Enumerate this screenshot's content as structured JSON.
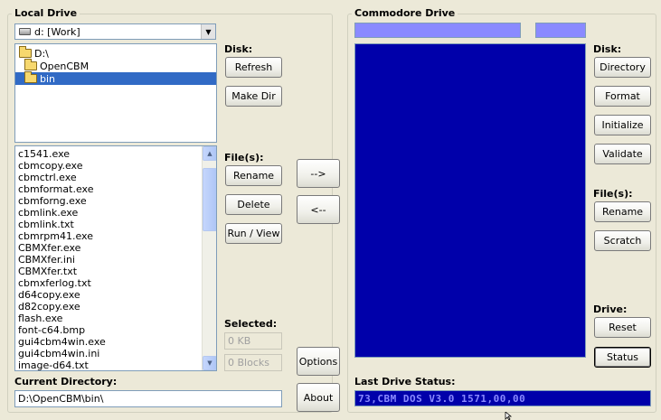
{
  "local": {
    "title": "Local Drive",
    "drive_select": "d: [Work]",
    "tree": [
      {
        "label": "D:\\",
        "selected": false
      },
      {
        "label": "OpenCBM",
        "selected": false
      },
      {
        "label": "bin",
        "selected": true
      }
    ],
    "files": [
      "c1541.exe",
      "cbmcopy.exe",
      "cbmctrl.exe",
      "cbmformat.exe",
      "cbmforng.exe",
      "cbmlink.exe",
      "cbmlink.txt",
      "cbmrpm41.exe",
      "CBMXfer.exe",
      "CBMXfer.ini",
      "CBMXfer.txt",
      "cbmxferlog.txt",
      "d64copy.exe",
      "d82copy.exe",
      "flash.exe",
      "font-c64.bmp",
      "gui4cbm4win.exe",
      "gui4cbm4win.ini",
      "image-d64.txt"
    ],
    "disk_label": "Disk:",
    "refresh": "Refresh",
    "make_dir": "Make Dir",
    "files_label": "File(s):",
    "rename": "Rename",
    "delete": "Delete",
    "run_view": "Run / View",
    "selected_label": "Selected:",
    "selected_kb": "0 KB",
    "selected_blocks": "0 Blocks",
    "current_dir_label": "Current Directory:",
    "current_dir": "D:\\OpenCBM\\bin\\"
  },
  "middle": {
    "copy_right": "-->",
    "copy_left": "<--",
    "options": "Options",
    "about": "About"
  },
  "cbm": {
    "title": "Commodore Drive",
    "disk_label": "Disk:",
    "directory": "Directory",
    "format": "Format",
    "initialize": "Initialize",
    "validate": "Validate",
    "files_label": "File(s):",
    "rename": "Rename",
    "scratch": "Scratch",
    "drive_label": "Drive:",
    "reset": "Reset",
    "status": "Status",
    "last_status_label": "Last Drive Status:",
    "last_status": "73,CBM DOS V3.0 1571,00,00"
  },
  "colors": {
    "cbm_blue": "#0000aa",
    "cbm_light_blue": "#8a8aff",
    "selection": "#316ac5"
  }
}
